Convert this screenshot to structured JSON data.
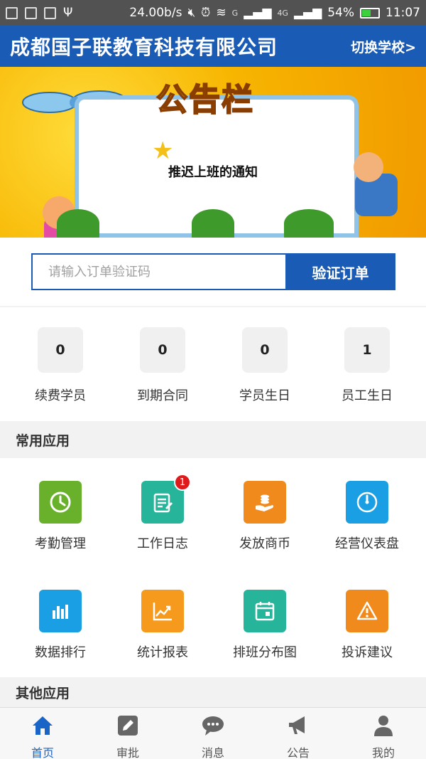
{
  "status_bar": {
    "speed": "24.00b/s",
    "network_labels": [
      "G",
      "4G"
    ],
    "battery": "54%",
    "time": "11:07"
  },
  "header": {
    "company": "成都国子联教育科技有限公司",
    "switch_school": "切换学校>"
  },
  "banner": {
    "title": "公告栏",
    "notice": "推迟上班的通知"
  },
  "verify": {
    "placeholder": "请输入订单验证码",
    "button": "验证订单"
  },
  "stats": [
    {
      "value": "0",
      "label": "续费学员"
    },
    {
      "value": "0",
      "label": "到期合同"
    },
    {
      "value": "0",
      "label": "学员生日"
    },
    {
      "value": "1",
      "label": "员工生日"
    }
  ],
  "sections": {
    "common": "常用应用",
    "other": "其他应用"
  },
  "apps": [
    {
      "label": "考勤管理",
      "icon": "clock-icon",
      "color": "#6ab12b"
    },
    {
      "label": "工作日志",
      "icon": "notepad-icon",
      "color": "#26b59a",
      "badge": "1"
    },
    {
      "label": "发放商币",
      "icon": "coins-hand-icon",
      "color": "#f08a1d"
    },
    {
      "label": "经营仪表盘",
      "icon": "gauge-icon",
      "color": "#1a9ee4"
    },
    {
      "label": "数据排行",
      "icon": "bar-chart-icon",
      "color": "#1a9ee4"
    },
    {
      "label": "统计报表",
      "icon": "trend-chart-icon",
      "color": "#f59a1d"
    },
    {
      "label": "排班分布图",
      "icon": "calendar-icon",
      "color": "#26b59a"
    },
    {
      "label": "投诉建议",
      "icon": "warning-icon",
      "color": "#f08a1d"
    }
  ],
  "bottom_nav": [
    {
      "label": "首页",
      "icon": "home-icon",
      "active": true
    },
    {
      "label": "审批",
      "icon": "edit-icon"
    },
    {
      "label": "消息",
      "icon": "chat-icon"
    },
    {
      "label": "公告",
      "icon": "megaphone-icon"
    },
    {
      "label": "我的",
      "icon": "user-icon"
    }
  ],
  "colors": {
    "primary": "#1a5bb5",
    "nav_active": "#1a64c8",
    "badge": "#e01a1a"
  }
}
